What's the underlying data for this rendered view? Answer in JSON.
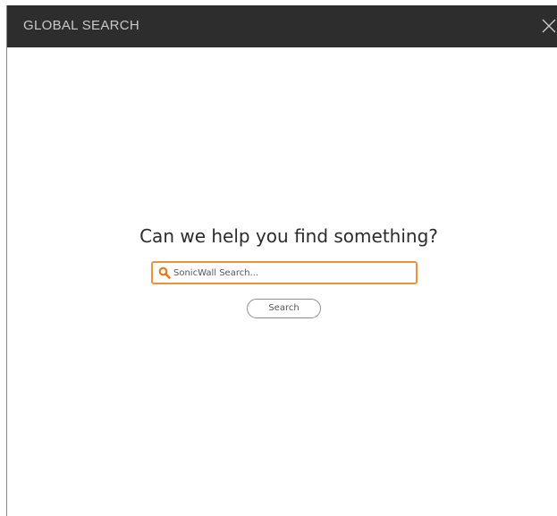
{
  "dialog": {
    "title": "GLOBAL SEARCH",
    "close_icon": "close-icon"
  },
  "main": {
    "headline": "Can we help you find something?",
    "search": {
      "placeholder": "SonicWall Search...",
      "value": "",
      "icon": "search-icon"
    },
    "search_button_label": "Search"
  },
  "colors": {
    "titlebar": "#2d2d2d",
    "title_text": "#c9c9c9",
    "accent": "#f0913a"
  }
}
